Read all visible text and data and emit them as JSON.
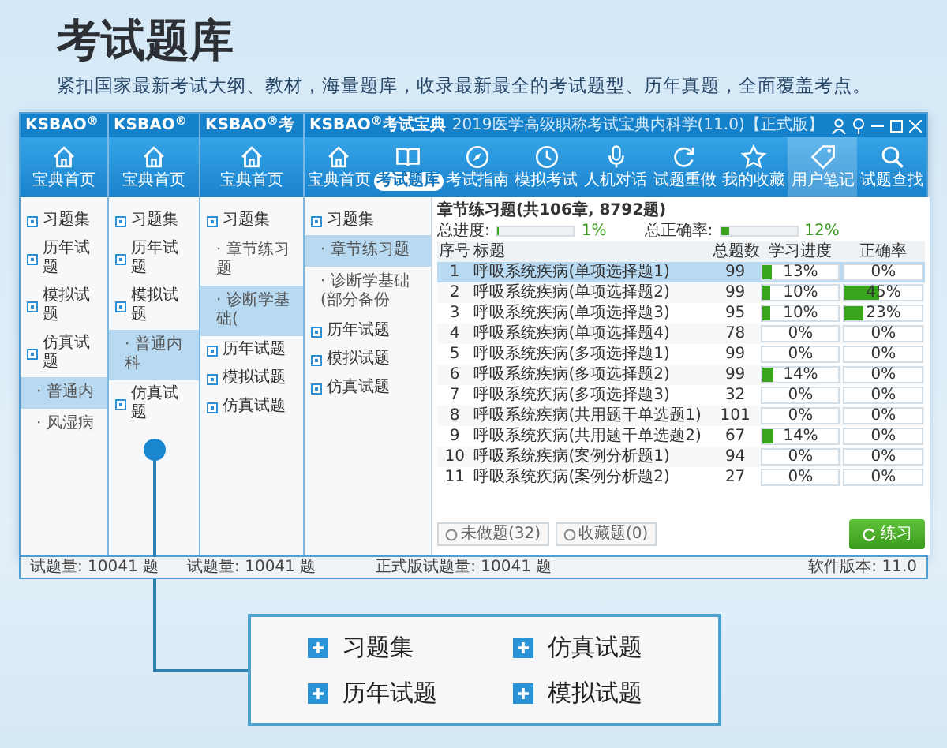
{
  "heading": "考试题库",
  "subtitle": "紧扣国家最新考试大纲、教材，海量题库，收录最新最全的考试题型、历年真题，全面覆盖考点。",
  "windows": [
    {
      "title": "KSBAO$^{®}$",
      "toolbar": [
        {
          "label": "宝典首页",
          "selected": false,
          "highlighted": false
        }
      ],
      "sidebar": [
        {
          "label": "习题集",
          "selected": false
        },
        {
          "label": "历年试题",
          "selected": false
        },
        {
          "label": "模拟试题",
          "selected": false
        },
        {
          "label": "仿真试题",
          "selected": false,
          "children": [
            {
              "label": "· 普通内",
              "selected": true
            },
            {
              "label": "· 风湿病",
              "selected": false
            }
          ]
        }
      ]
    },
    {
      "title": "KSBAO$^{®}$",
      "toolbar": [
        {
          "label": "宝典首页",
          "selected": false,
          "highlighted": false
        }
      ],
      "sidebar": [
        {
          "label": "习题集",
          "selected": false
        },
        {
          "label": "历年试题",
          "selected": false
        },
        {
          "label": "模拟试题",
          "selected": false,
          "children": [
            {
              "label": "· 普通内科",
              "selected": true
            }
          ]
        },
        {
          "label": "仿真试题",
          "selected": false
        }
      ]
    },
    {
      "title": "KSBAO$^{®}$考",
      "toolbar": [
        {
          "label": "宝典首页",
          "selected": false,
          "highlighted": false
        }
      ],
      "sidebar": [
        {
          "label": "习题集",
          "selected": false,
          "children": [
            {
              "label": "· 章节练习题",
              "selected": false
            },
            {
              "label": "· 诊断学基础(",
              "selected": true
            }
          ]
        },
        {
          "label": "历年试题",
          "selected": false
        },
        {
          "label": "模拟试题",
          "selected": false
        },
        {
          "label": "仿真试题",
          "selected": false
        }
      ]
    }
  ],
  "front": {
    "title": "KSBAO$^{®}$考试宝典",
    "caption": "2019医学高级职称考试宝典内科学(11.0)【正式版】",
    "toolbar": [
      {
        "label": "宝典首页",
        "selected": false,
        "highlighted": false
      },
      {
        "label": "考试题库",
        "selected": true,
        "highlighted": false
      },
      {
        "label": "考试指南",
        "selected": false,
        "highlighted": false
      },
      {
        "label": "模拟考试",
        "selected": false,
        "highlighted": false
      },
      {
        "label": "人机对话",
        "selected": false,
        "highlighted": false
      },
      {
        "label": "试题重做",
        "selected": false,
        "highlighted": false
      },
      {
        "label": "我的收藏",
        "selected": false,
        "highlighted": false
      },
      {
        "label": "用户笔记",
        "selected": false,
        "highlighted": true
      },
      {
        "label": "试题查找",
        "selected": false,
        "highlighted": false
      }
    ],
    "sidebar": [
      {
        "label": "习题集",
        "selected": false,
        "children": [
          {
            "label": "· 章节练习题",
            "selected": true
          },
          {
            "label": "· 诊断学基础(部分备份",
            "selected": false
          }
        ]
      },
      {
        "label": "历年试题",
        "selected": false
      },
      {
        "label": "模拟试题",
        "selected": false
      },
      {
        "label": "仿真试题",
        "selected": false
      }
    ],
    "panel": {
      "heading": "章节练习题(共106章, 8792题)",
      "progress": {
        "label": "总进度:",
        "level": 0.01,
        "value": "1%"
      },
      "accuracy": {
        "label": "总正确率:",
        "level": 0.12,
        "value": "12%"
      },
      "columns": [
        "序号",
        "标题",
        "总题数",
        "学习进度",
        "正确率"
      ],
      "rows": [
        {
          "index": "1",
          "title": "呼吸系统疾病(单项选择题1)",
          "total": "99",
          "progress": {
            "value": "13%",
            "level": 0.13
          },
          "accuracy": {
            "value": "0%",
            "level": 0
          },
          "selected": true
        },
        {
          "index": "2",
          "title": "呼吸系统疾病(单项选择题2)",
          "total": "99",
          "progress": {
            "value": "10%",
            "level": 0.1
          },
          "accuracy": {
            "value": "45%",
            "level": 0.45
          },
          "selected": false
        },
        {
          "index": "3",
          "title": "呼吸系统疾病(单项选择题3)",
          "total": "95",
          "progress": {
            "value": "10%",
            "level": 0.1
          },
          "accuracy": {
            "value": "23%",
            "level": 0.23
          },
          "selected": false
        },
        {
          "index": "4",
          "title": "呼吸系统疾病(单项选择题4)",
          "total": "78",
          "progress": {
            "value": "0%",
            "level": 0
          },
          "accuracy": {
            "value": "0%",
            "level": 0
          },
          "selected": false
        },
        {
          "index": "5",
          "title": "呼吸系统疾病(多项选择题1)",
          "total": "99",
          "progress": {
            "value": "0%",
            "level": 0
          },
          "accuracy": {
            "value": "0%",
            "level": 0
          },
          "selected": false
        },
        {
          "index": "6",
          "title": "呼吸系统疾病(多项选择题2)",
          "total": "99",
          "progress": {
            "value": "14%",
            "level": 0.14
          },
          "accuracy": {
            "value": "0%",
            "level": 0
          },
          "selected": false
        },
        {
          "index": "7",
          "title": "呼吸系统疾病(多项选择题3)",
          "total": "32",
          "progress": {
            "value": "0%",
            "level": 0
          },
          "accuracy": {
            "value": "0%",
            "level": 0
          },
          "selected": false
        },
        {
          "index": "8",
          "title": "呼吸系统疾病(共用题干单选题1)",
          "total": "101",
          "progress": {
            "value": "0%",
            "level": 0
          },
          "accuracy": {
            "value": "0%",
            "level": 0
          },
          "selected": false
        },
        {
          "index": "9",
          "title": "呼吸系统疾病(共用题干单选题2)",
          "total": "67",
          "progress": {
            "value": "14%",
            "level": 0.14
          },
          "accuracy": {
            "value": "0%",
            "level": 0
          },
          "selected": false
        },
        {
          "index": "10",
          "title": "呼吸系统疾病(案例分析题1)",
          "total": "94",
          "progress": {
            "value": "0%",
            "level": 0
          },
          "accuracy": {
            "value": "0%",
            "level": 0
          },
          "selected": false
        },
        {
          "index": "11",
          "title": "呼吸系统疾病(案例分析题2)",
          "total": "27",
          "progress": {
            "value": "0%",
            "level": 0
          },
          "accuracy": {
            "value": "0%",
            "level": 0
          },
          "selected": false
        }
      ],
      "filters": [
        "未做题(32)",
        "收藏题(0)"
      ],
      "practice_button": "练习"
    }
  },
  "status": [
    "试题量: 10041 题",
    "试题量: 10041 题",
    "正式版试题量: 10041 题"
  ],
  "version": "软件版本: 11.0",
  "callout": [
    "习题集",
    "仿真试题",
    "历年试题",
    "模拟试题"
  ]
}
